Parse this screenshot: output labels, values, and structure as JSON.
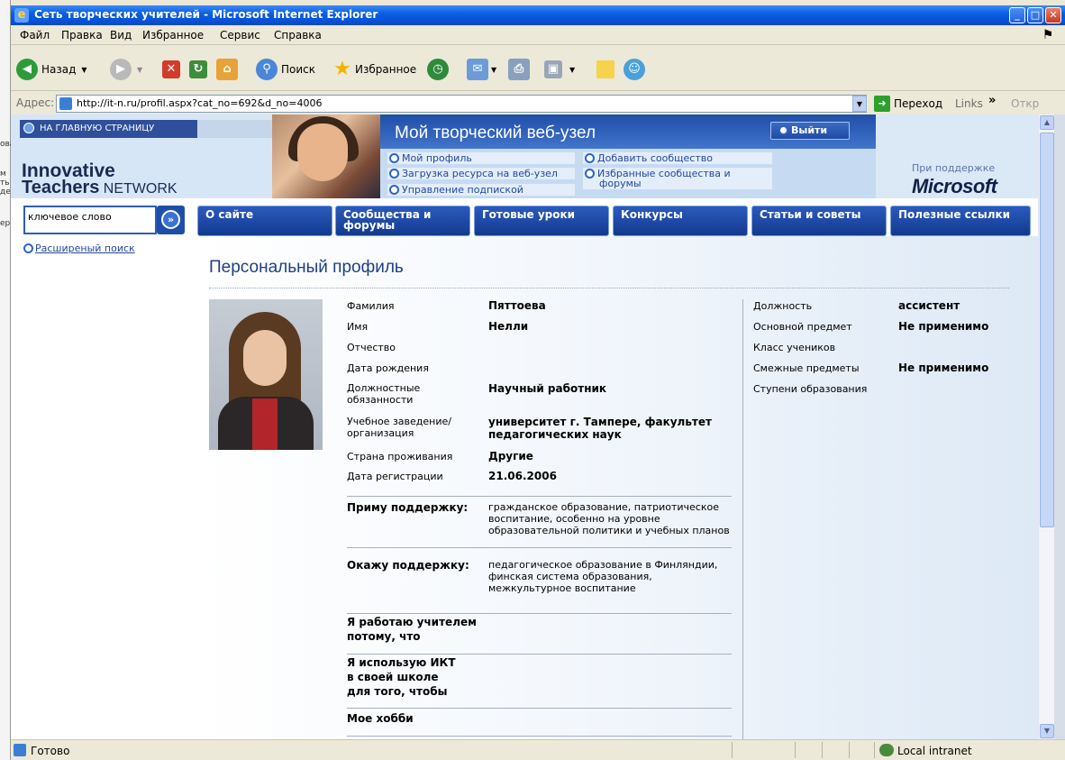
{
  "background_fragments": [
    "ова",
    "м",
    "ть",
    "дет",
    "ер"
  ],
  "window": {
    "title": "Сеть творческих учителей - Microsoft Internet Explorer",
    "buttons": [
      "_",
      "□",
      "✕"
    ]
  },
  "menu": [
    "Файл",
    "Правка",
    "Вид",
    "Избранное",
    "Сервис",
    "Справка"
  ],
  "toolbar": {
    "back_label": "Назад",
    "search_label": "Поиск",
    "favorites_label": "Избранное"
  },
  "addressbar": {
    "label": "Адрес:",
    "url": "http://it-n.ru/profil.aspx?cat_no=692&d_no=4006",
    "go_label": "Переход",
    "links_label": "Links",
    "more_label": "Откр"
  },
  "page": {
    "home_link": "НА ГЛАВНУЮ СТРАНИЦУ",
    "logo_line1": "Innovative",
    "logo_line2_bold": "Teachers",
    "logo_line2_rest": " NETWORK",
    "site_title": "Мой творческий веб-узел",
    "logout_label": "Выйти",
    "submenu": {
      "profile": "Мой профиль",
      "upload": "Загрузка ресурса на веб-узел",
      "subscriptions": "Управление подпиской",
      "add_community": "Добавить сообщество",
      "fav_communities": "Избранные сообщества и форумы"
    },
    "sponsor_label": "При поддержке",
    "ms_logo": "Microsoft",
    "search_placeholder": "ключевое слово",
    "advanced_search": "Расширеный поиск",
    "nav": [
      "О сайте",
      "Сообщества и форумы",
      "Готовые уроки",
      "Конкурсы",
      "Статьи и советы",
      "Полезные ссылки"
    ],
    "profile_title": "Персональный профиль"
  },
  "profile": {
    "surname_label": "Фамилия",
    "surname": "Пяттоева",
    "name_label": "Имя",
    "name": "Нелли",
    "patronymic_label": "Отчество",
    "birth_label": "Дата рождения",
    "duties_label": "Должностные обязанности",
    "duties": "Научный работник",
    "institution_label": "Учебное заведение/организация",
    "institution": "университет г. Тампере, факультет педагогических наук",
    "country_label": "Страна проживания",
    "country": "Другие",
    "reg_label": "Дата регистрации",
    "reg_date": "21.06.2006",
    "position_label": "Должность",
    "position": "ассистент",
    "subject_label": "Основной предмет",
    "subject": "Не применимо",
    "class_label": "Класс учеников",
    "related_label": "Смежные предметы",
    "related": "Не применимо",
    "levels_label": "Ступени образования",
    "accept_support_label": "Приму поддержку:",
    "accept_support": "гражданское образование, патриотическое воспитание, особенно на уровне образовательной политики и учебных планов",
    "give_support_label": "Окажу поддержку:",
    "give_support": "педагогическое образование в Финляндии, финская система образования, межкультурное воспитание",
    "why_teacher_label": "Я работаю учителем потому, что",
    "ict_label": "Я использую ИКТ в своей школе для того, чтобы",
    "hobby_label": "Мое хобби"
  },
  "status": {
    "text": "Готово",
    "zone": "Local intranet"
  }
}
